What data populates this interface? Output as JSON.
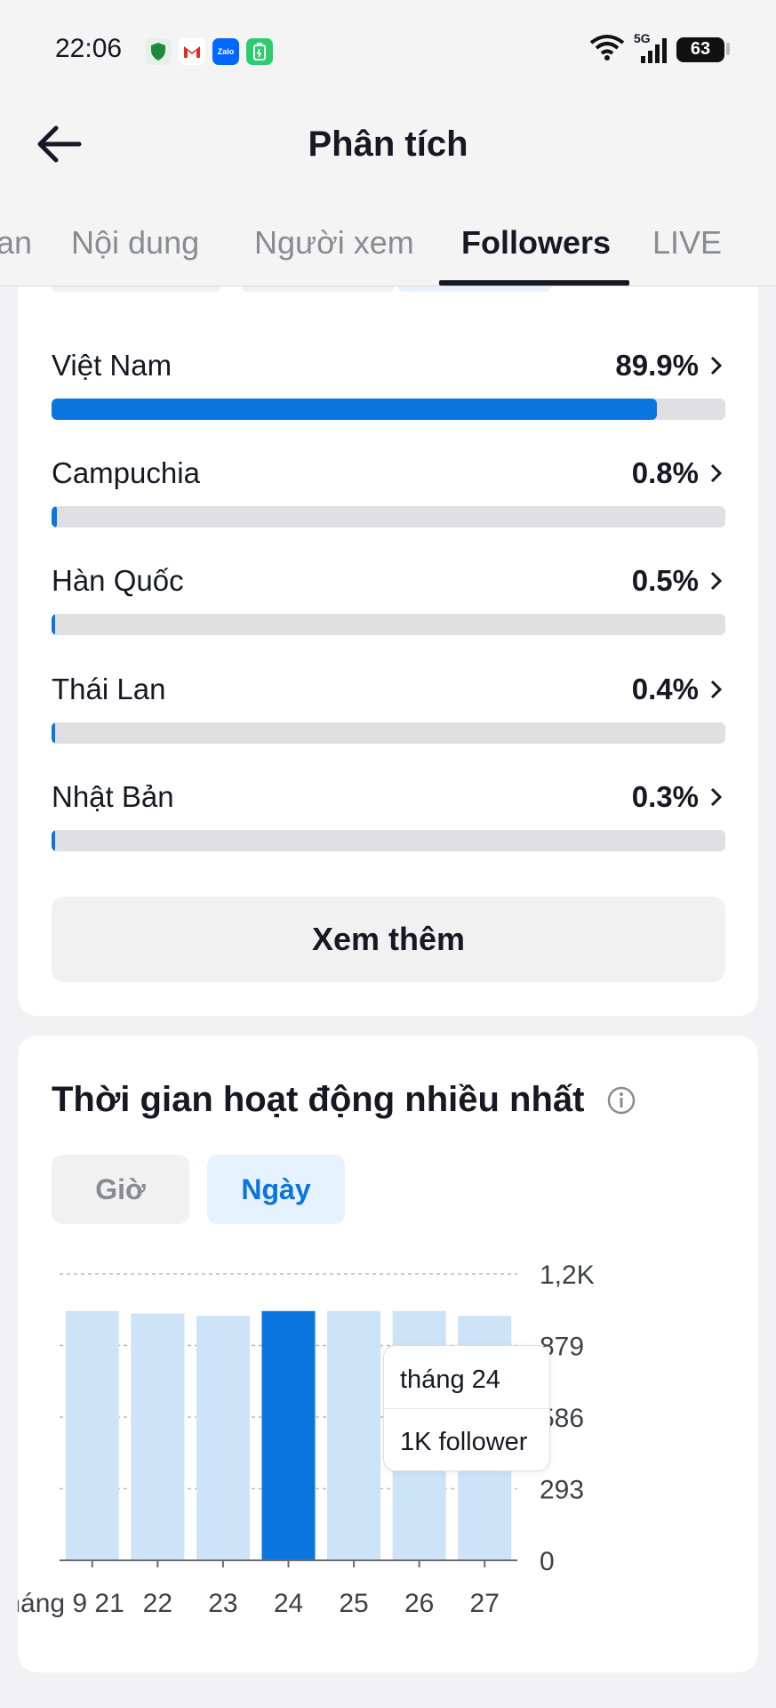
{
  "status_bar": {
    "time": "22:06",
    "network": "5G",
    "battery": "63",
    "notification_icons": [
      "shield-icon",
      "gmail-icon",
      "zalo-icon",
      "battery-saver-icon"
    ]
  },
  "header": {
    "title": "Phân tích"
  },
  "tabs": [
    {
      "label": "an"
    },
    {
      "label": "Nội dung"
    },
    {
      "label": "Người xem"
    },
    {
      "label": "Followers",
      "active": true
    },
    {
      "label": "LIVE"
    }
  ],
  "countries": {
    "items": [
      {
        "name": "Việt Nam",
        "percent_label": "89.9%",
        "fraction": 0.899
      },
      {
        "name": "Campuchia",
        "percent_label": "0.8%",
        "fraction": 0.008
      },
      {
        "name": "Hàn Quốc",
        "percent_label": "0.5%",
        "fraction": 0.005
      },
      {
        "name": "Thái Lan",
        "percent_label": "0.4%",
        "fraction": 0.004
      },
      {
        "name": "Nhật Bản",
        "percent_label": "0.3%",
        "fraction": 0.003
      }
    ],
    "more_button": "Xem thêm"
  },
  "activity": {
    "title": "Thời gian hoạt động nhiều nhất",
    "segments": {
      "hour": "Giờ",
      "day": "Ngày",
      "selected": "day"
    },
    "tooltip": {
      "line1": "tháng 24",
      "line2": "1K follower"
    }
  },
  "colors": {
    "accent": "#0a75de",
    "bar_light": "#cce3f8",
    "track": "#e0e0e2"
  },
  "chart_data": {
    "type": "bar",
    "categories": [
      "21",
      "22",
      "23",
      "24",
      "25",
      "26",
      "27"
    ],
    "x_tick_labels": [
      "háng 9 21",
      "22",
      "23",
      "24",
      "25",
      "26",
      "27"
    ],
    "values": [
      1020,
      1010,
      1000,
      1020,
      1020,
      1020,
      1000
    ],
    "highlighted_index": 3,
    "y_ticks": [
      0,
      293,
      586,
      879,
      1172
    ],
    "y_tick_labels": [
      "0",
      "293",
      "586",
      "879",
      "1,2K"
    ],
    "ylim": [
      0,
      1172
    ],
    "grid": true,
    "title": "",
    "xlabel": "",
    "ylabel": ""
  }
}
